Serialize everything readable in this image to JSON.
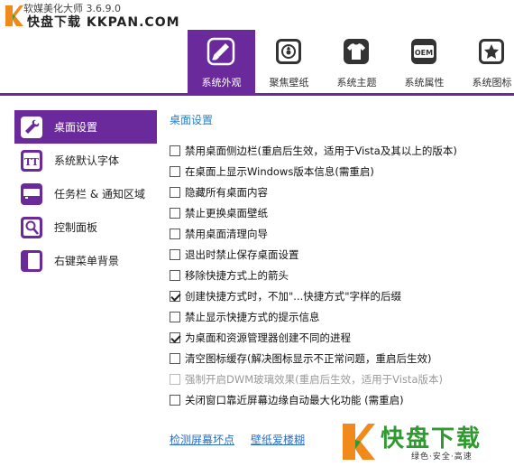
{
  "app": {
    "title": "软媒美化大师 3.6.9.0",
    "watermark_top": "快盘下载 KKPAN.COM"
  },
  "tabs": [
    {
      "label": "系统外观",
      "icon": "paintbrush-icon",
      "active": true
    },
    {
      "label": "聚焦壁纸",
      "icon": "wallpaper-icon",
      "active": false
    },
    {
      "label": "系统主题",
      "icon": "tshirt-icon",
      "active": false
    },
    {
      "label": "系统属性",
      "icon": "oem-icon",
      "active": false
    },
    {
      "label": "系统图标",
      "icon": "star-icon",
      "active": false
    }
  ],
  "sidebar": {
    "items": [
      {
        "label": "桌面设置",
        "icon": "wrench-icon",
        "active": true
      },
      {
        "label": "系统默认字体",
        "icon": "font-icon",
        "active": false
      },
      {
        "label": "任务栏 & 通知区域",
        "icon": "taskbar-icon",
        "active": false
      },
      {
        "label": "控制面板",
        "icon": "control-panel-icon",
        "active": false
      },
      {
        "label": "右键菜单背景",
        "icon": "context-menu-icon",
        "active": false
      }
    ]
  },
  "main": {
    "section_title": "桌面设置",
    "options": [
      {
        "label": "禁用桌面侧边栏(重启后生效，适用于Vista及其以上的版本)",
        "checked": false,
        "disabled": false
      },
      {
        "label": "在桌面上显示Windows版本信息(需重启)",
        "checked": false,
        "disabled": false
      },
      {
        "label": "隐藏所有桌面内容",
        "checked": false,
        "disabled": false
      },
      {
        "label": "禁止更换桌面壁纸",
        "checked": false,
        "disabled": false
      },
      {
        "label": "禁用桌面清理向导",
        "checked": false,
        "disabled": false
      },
      {
        "label": "退出时禁止保存桌面设置",
        "checked": false,
        "disabled": false
      },
      {
        "label": "移除快捷方式上的箭头",
        "checked": false,
        "disabled": false
      },
      {
        "label": "创建快捷方式时，不加\"...快捷方式\"字样的后缀",
        "checked": true,
        "disabled": false
      },
      {
        "label": "禁止显示快捷方式的提示信息",
        "checked": false,
        "disabled": false
      },
      {
        "label": "为桌面和资源管理器创建不同的进程",
        "checked": true,
        "disabled": false
      },
      {
        "label": "清空图标缓存(解决图标显示不正常问题，重启后生效)",
        "checked": false,
        "disabled": false
      },
      {
        "label": "强制开启DWM玻璃效果(重启后生效，适用于Vista版本)",
        "checked": false,
        "disabled": true
      },
      {
        "label": "关闭窗口靠近屏幕边缘自动最大化功能 (需重启)",
        "checked": false,
        "disabled": false
      }
    ]
  },
  "footer": {
    "link1": "检测屏幕坏点",
    "link2": "壁纸爱楼糊"
  },
  "watermark_bottom": {
    "text": "快盘下载",
    "sub": "绿色·安全·高速"
  },
  "colors": {
    "accent": "#6a2a9c",
    "link": "#2a6fc8",
    "watermark_green": "#2f9a2f",
    "watermark_orange": "#f08a1c"
  }
}
